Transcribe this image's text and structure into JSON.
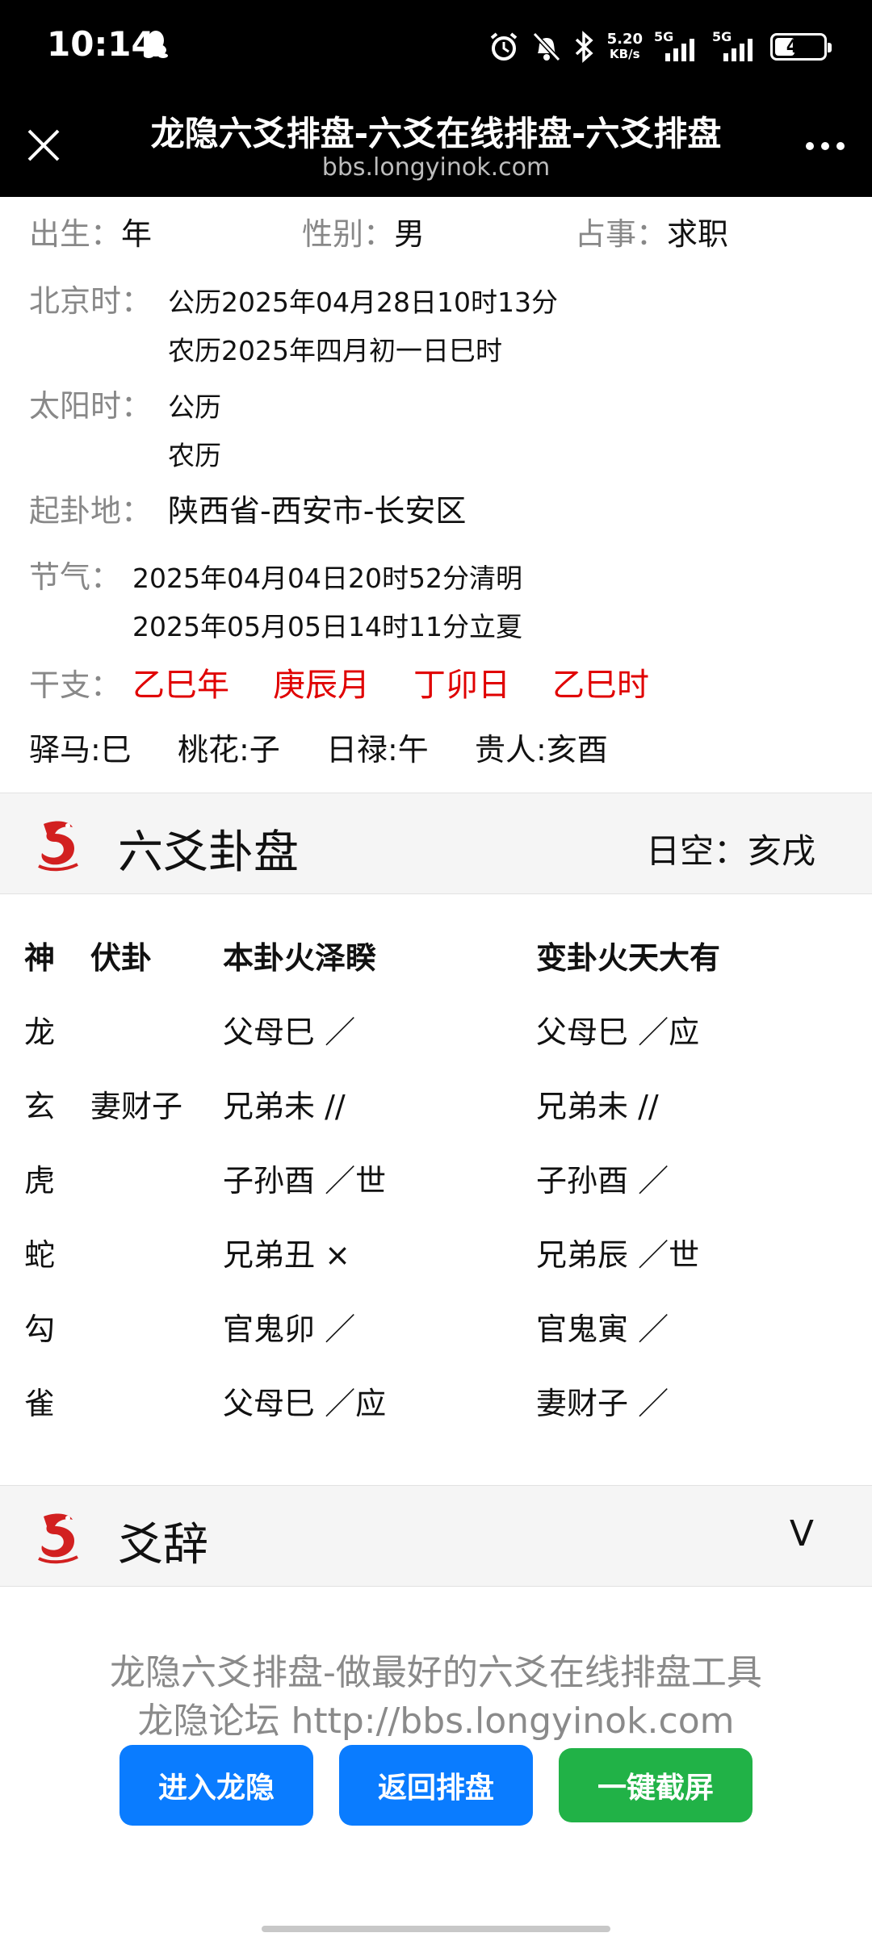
{
  "status_bar": {
    "time": "10:14",
    "net_speed_value": "5.20",
    "net_speed_unit": "KB/s",
    "sim1": "5G",
    "sim2": "5G",
    "battery_level": 41,
    "battery_label": "41"
  },
  "titlebar": {
    "title": "龙隐六爻排盘-六爻在线排盘-六爻排盘",
    "url": "bbs.longyinok.com"
  },
  "info": {
    "birth_label": "出生：",
    "birth_value": "年",
    "gender_label": "性别：",
    "gender_value": "男",
    "matter_label": "占事：",
    "matter_value": "求职",
    "beijing_label": "北京时：",
    "beijing_solar": "公历2025年04月28日10时13分",
    "beijing_lunar": "农历2025年四月初一日巳时",
    "sun_label": "太阳时：",
    "sun_solar": "公历",
    "sun_lunar": "农历",
    "place_label": "起卦地：",
    "place_value": "陕西省-西安市-长安区",
    "jieqi_label": "节气：",
    "jieqi_1": "2025年04月04日20时52分清明",
    "jieqi_2": "2025年05月05日14时11分立夏",
    "ganzhi_label": "干支：",
    "ganzhi": [
      "乙巳年",
      "庚辰月",
      "丁卯日",
      "乙巳时"
    ],
    "shensha": [
      "驿马:巳",
      "桃花:子",
      "日禄:午",
      "贵人:亥酉"
    ]
  },
  "gua_section": {
    "title": "六爻卦盘",
    "kong_label": "日空：",
    "kong_value": "亥戌"
  },
  "gua_table": {
    "headers": [
      "神",
      "伏卦",
      "本卦火泽睽",
      "变卦火天大有"
    ],
    "rows": [
      {
        "shen": "龙",
        "fu": "",
        "ben": "父母巳 ／",
        "bian": "父母巳 ／应"
      },
      {
        "shen": "玄",
        "fu": "妻财子",
        "ben": "兄弟未 //",
        "bian": "兄弟未 //"
      },
      {
        "shen": "虎",
        "fu": "",
        "ben": "子孙酉 ／世",
        "bian": "子孙酉 ／"
      },
      {
        "shen": "蛇",
        "fu": "",
        "ben": "兄弟丑 ×",
        "bian": "兄弟辰 ／世"
      },
      {
        "shen": "勾",
        "fu": "",
        "ben": "官鬼卯 ／",
        "bian": "官鬼寅 ／"
      },
      {
        "shen": "雀",
        "fu": "",
        "ben": "父母巳 ／应",
        "bian": "妻财子 ／"
      }
    ]
  },
  "yaoci_section": {
    "title": "爻辞",
    "toggle": "V"
  },
  "footer": {
    "line1": "龙隐六爻排盘-做最好的六爻在线排盘工具",
    "line2": "龙隐论坛 http://bbs.longyinok.com",
    "buttons": [
      "进入龙隐",
      "返回排盘",
      "一键截屏"
    ]
  },
  "colors": {
    "accent_blue": "#0a7cff",
    "accent_green": "#21b247",
    "ganzhi_red": "#e00000",
    "label_gray": "#888888"
  }
}
